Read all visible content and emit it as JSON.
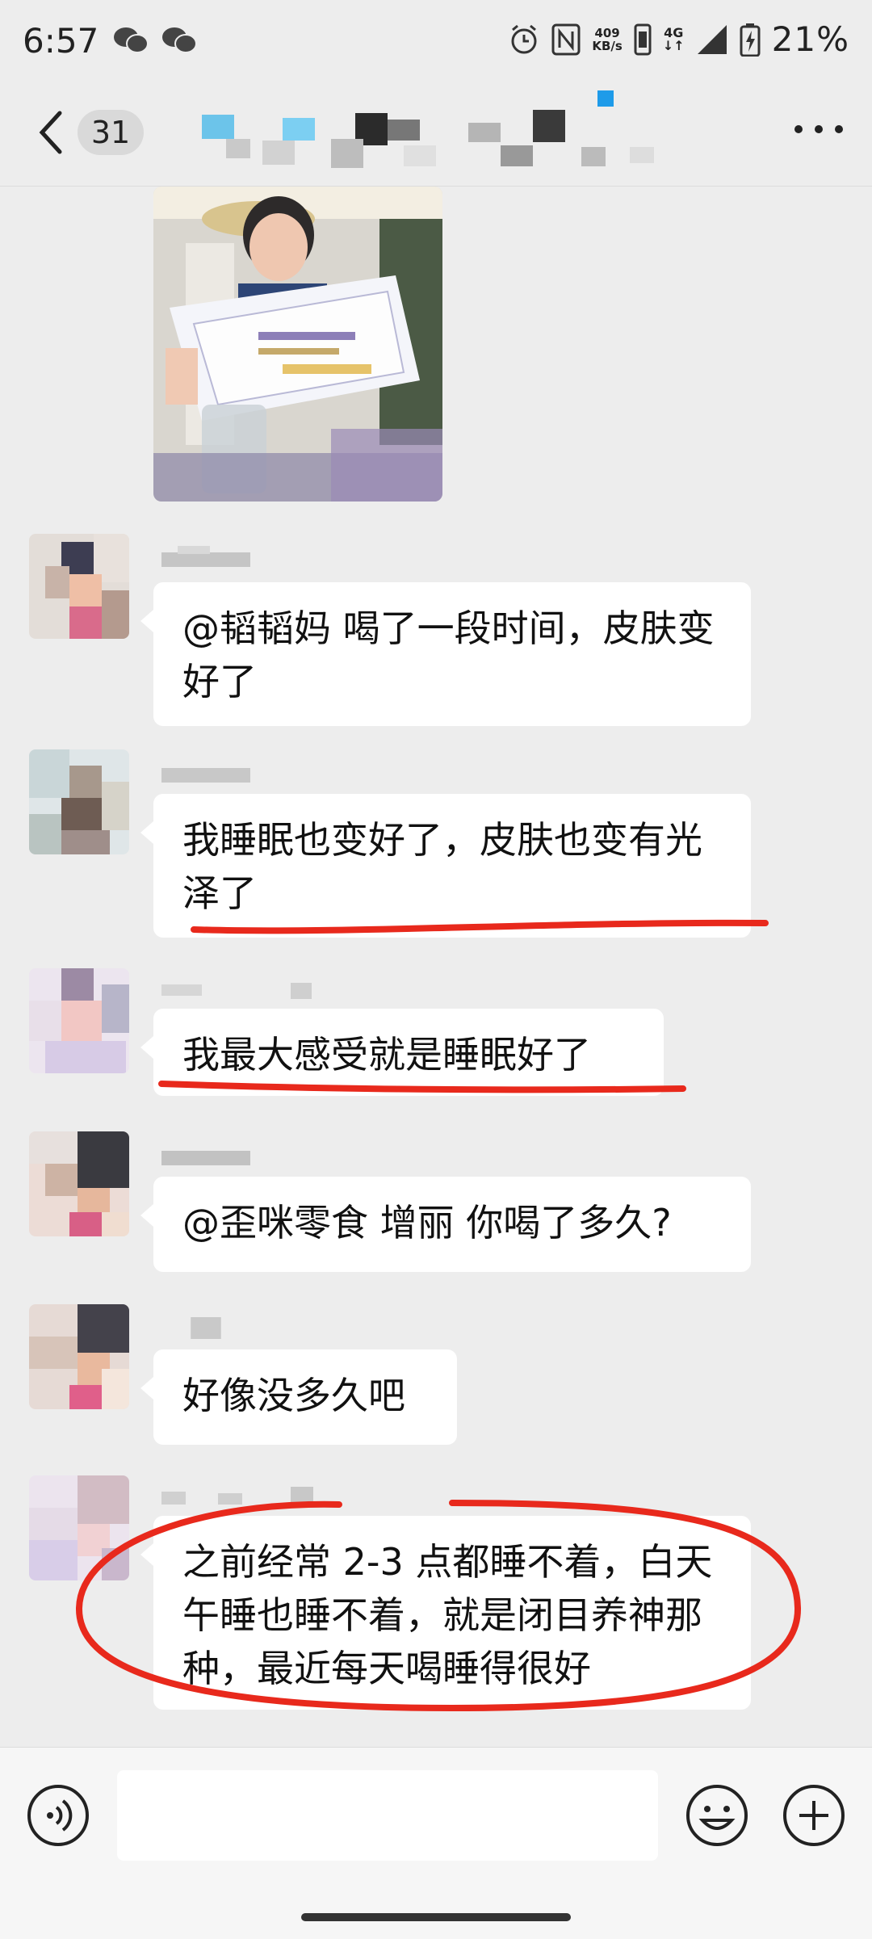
{
  "status_bar": {
    "time": "6:57",
    "net_speed_value": "409",
    "net_speed_unit": "KB/s",
    "network": "4G",
    "battery": "21%"
  },
  "header": {
    "unread_count": "31"
  },
  "messages": [
    {
      "text": "@韬韬妈  喝了一段时间，皮肤变好了"
    },
    {
      "text": "我睡眠也变好了，皮肤也变有光泽了"
    },
    {
      "text": "我最大感受就是睡眠好了"
    },
    {
      "text": "@歪咪零食  增丽  你喝了多久?"
    },
    {
      "text": "好像没多久吧"
    },
    {
      "text": "之前经常 2-3 点都睡不着，白天午睡也睡不着，就是闭目养神那种，最近每天喝睡得很好"
    }
  ],
  "colors": {
    "annotation_red": "#e8291c",
    "background": "#ededed",
    "bubble": "#ffffff"
  },
  "icons": [
    "back-icon",
    "more-icon",
    "voice-icon",
    "emoji-icon",
    "plus-icon",
    "wechat-icon",
    "alarm-icon",
    "nfc-icon",
    "signal-icon",
    "battery-icon"
  ]
}
